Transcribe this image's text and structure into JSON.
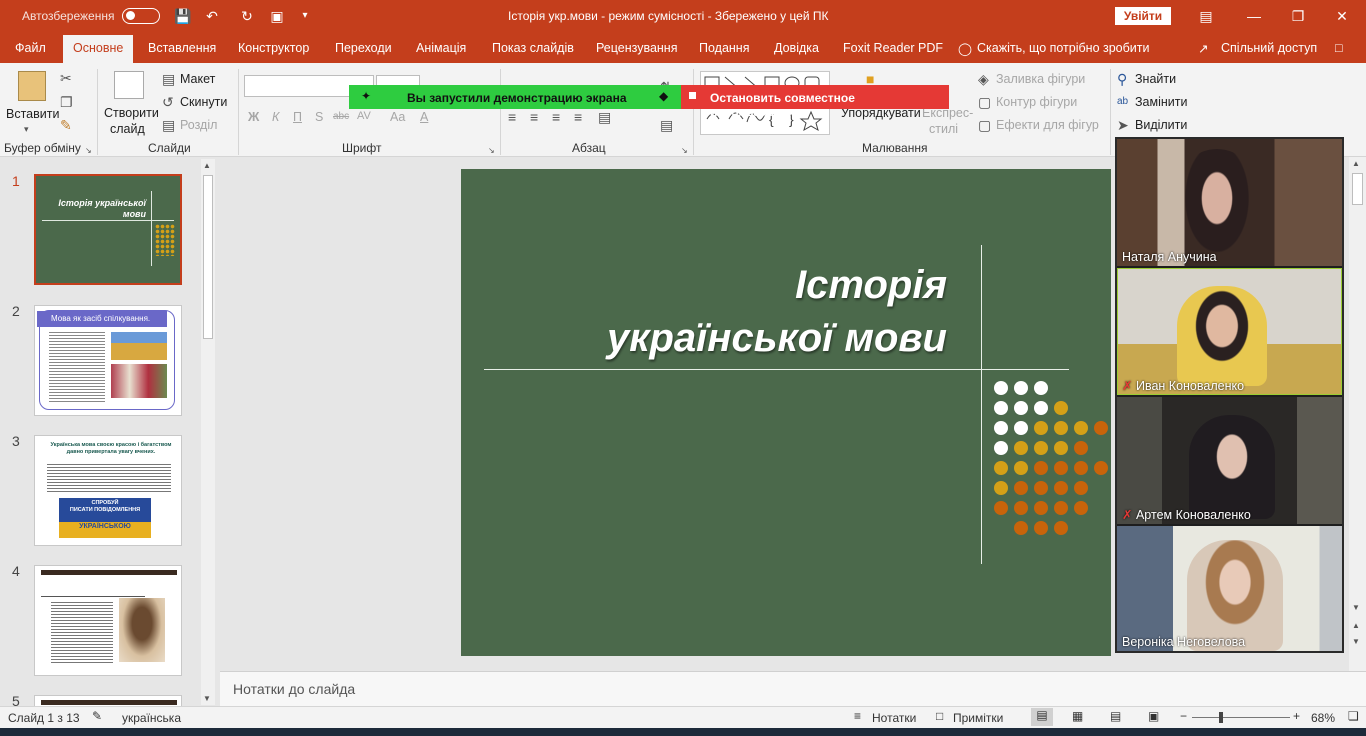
{
  "titlebar": {
    "autosave_label": "Автозбереження",
    "title": "Історія укр.мови  -  режим сумісності  -  Збережено у цей ПК",
    "signin": "Увійти"
  },
  "tabs": [
    "Файл",
    "Основне",
    "Вставлення",
    "Конструктор",
    "Переходи",
    "Анімація",
    "Показ слайдів",
    "Рецензування",
    "Подання",
    "Довідка",
    "Foxit Reader PDF"
  ],
  "tellme": "Скажіть, що потрібно зробити",
  "share": "Спільний доступ",
  "ribbon": {
    "paste": "Вставити",
    "new_slide_1": "Створити",
    "new_slide_2": "слайд",
    "layout": "Макет",
    "reset": "Скинути",
    "section": "Розділ",
    "arrange": "Упорядкувати",
    "quick_styles_1": "Експрес-",
    "quick_styles_2": "стилі",
    "shape_fill": "Заливка фігури",
    "shape_outline": "Контур фігури",
    "shape_effects": "Ефекти для фігур",
    "find": "Знайти",
    "replace": "Замінити",
    "select": "Виділити",
    "groups": {
      "clipboard": "Буфер обміну",
      "slides": "Слайди",
      "font": "Шрифт",
      "paragraph": "Абзац",
      "drawing": "Малювання"
    },
    "font_buttons": [
      "Ж",
      "К",
      "П",
      "S",
      "abc",
      "AV",
      "Aa",
      "A"
    ]
  },
  "sharing_banner": {
    "started": "Вы запустили демонстрацию экрана",
    "stop": "Остановить совместное использование"
  },
  "slides": {
    "numbers": [
      "1",
      "2",
      "3",
      "4",
      "5"
    ],
    "thumb1_title": "Історія української мови",
    "thumb2_title": "Мова як засіб спілкування.",
    "thumb3_title": "Українська мова своєю красою і багатством давно привертала увагу вчених.",
    "thumb3_banner_1": "СПРОБУЙ",
    "thumb3_banner_2": "ПИСАТИ ПОВІДОМЛЕННЯ",
    "thumb3_banner_3": "УКРАЇНСЬКОЮ"
  },
  "main_slide": {
    "title_line1": "Історія",
    "title_line2": "української мови",
    "dot_colors": {
      "white": "#ffffff",
      "gold": "#d4a017",
      "orange": "#c8640a"
    }
  },
  "notes_placeholder": "Нотатки до слайда",
  "status": {
    "slide_of": "Слайд 1 з 13",
    "language": "українська",
    "notes": "Нотатки",
    "comments": "Примітки",
    "zoom": "68%"
  },
  "participants": [
    {
      "name": "Наталя Анучина",
      "muted": false
    },
    {
      "name": "Иван Коноваленко",
      "muted": true
    },
    {
      "name": "Артем Коноваленко",
      "muted": true
    },
    {
      "name": "Вероніка Неговелова",
      "muted": false
    }
  ],
  "colors": {
    "accent": "#c43e1c",
    "slide_bg": "#4b694b",
    "share_green": "#2ecc40",
    "share_red": "#e53935"
  }
}
